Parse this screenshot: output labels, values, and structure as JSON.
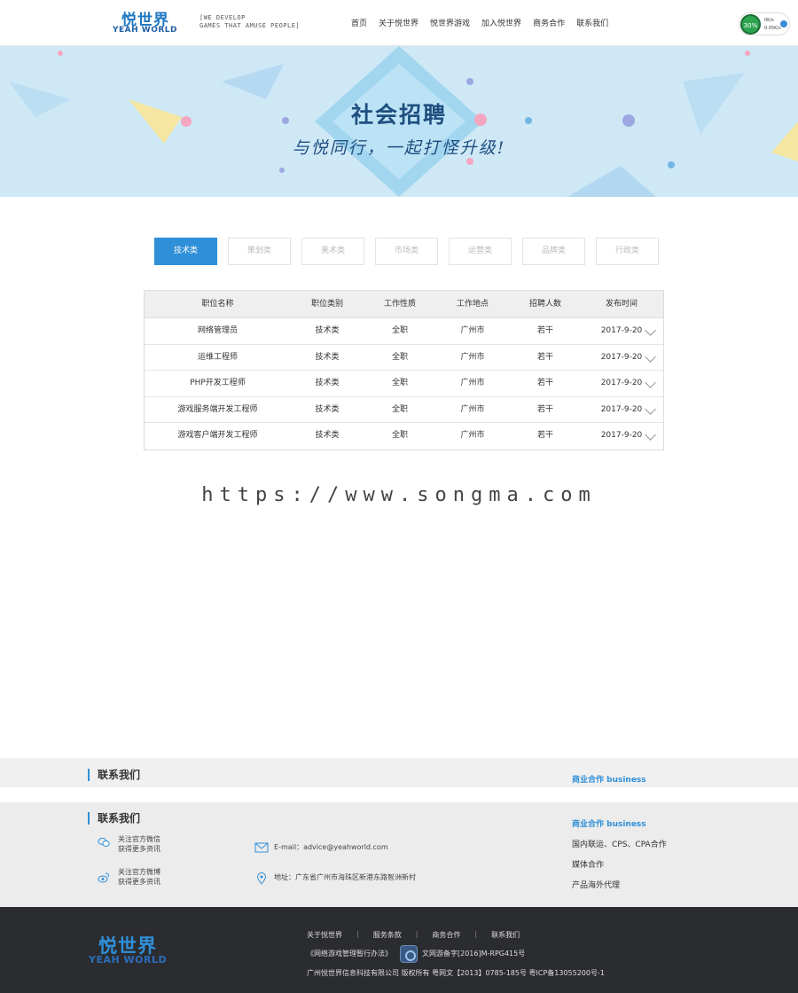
{
  "header": {
    "logo_cn": "悦世界",
    "logo_en": "YEAH WORLD",
    "slogan_line1": "[WE DEVELOP",
    "slogan_line2": "GAMES THAT AMUSE PEOPLE]",
    "nav": [
      "首页",
      "关于悦世界",
      "悦世界游戏",
      "加入悦世界",
      "商务合作",
      "联系我们"
    ],
    "speed_percent": "30%",
    "speed_up": "0K/s",
    "speed_down": "0.05K/s"
  },
  "banner": {
    "title": "社会招聘",
    "subtitle": "与悦同行，一起打怪升级!",
    "colors": {
      "bg": "#cfe8f6",
      "text": "#1e4f80"
    }
  },
  "tabs": [
    "技术类",
    "策划类",
    "美术类",
    "市场类",
    "运营类",
    "品牌类",
    "行政类"
  ],
  "jobs": {
    "headers": [
      "职位名称",
      "职位类别",
      "工作性质",
      "工作地点",
      "招聘人数",
      "发布时间"
    ],
    "rows": [
      [
        "网络管理员",
        "技术类",
        "全职",
        "广州市",
        "若干",
        "2017-9-20"
      ],
      [
        "运维工程师",
        "技术类",
        "全职",
        "广州市",
        "若干",
        "2017-9-20"
      ],
      [
        "PHP开发工程师",
        "技术类",
        "全职",
        "广州市",
        "若干",
        "2017-9-20"
      ],
      [
        "游戏服务端开发工程师",
        "技术类",
        "全职",
        "广州市",
        "若干",
        "2017-9-20"
      ],
      [
        "游戏客户端开发工程师",
        "技术类",
        "全职",
        "广州市",
        "若干",
        "2017-9-20"
      ]
    ]
  },
  "watermark": "https://www.songma.com",
  "strip": {
    "title": "联系我们",
    "biz": "商业合作 business"
  },
  "contact": {
    "title": "联系我们",
    "wechat_line1": "关注官方微信",
    "wechat_line2": "获得更多资讯",
    "weibo_line1": "关注官方微博",
    "weibo_line2": "获得更多资讯",
    "email": "E-mail：advice@yeahworld.com",
    "address": "地址：广东省广州市海珠区新港东路智洲新村",
    "biz_title": "商业合作 business",
    "biz_items": [
      "国内联运、CPS、CPA合作",
      "媒体合作",
      "产品海外代理"
    ]
  },
  "footer": {
    "logo_cn": "悦世界",
    "logo_en": "YEAH WORLD",
    "links": [
      "关于悦世界",
      "服务条款",
      "商务合作",
      "联系我们"
    ],
    "license": "《网络游戏管理暂行办法》",
    "license_no": "文网游备字[2016]M-RPG415号",
    "copyright": "广州悦世界信息科技有限公司 版权所有 粤网文【2013】0785-185号 粤ICP备13055200号-1"
  },
  "accent_color": "#2f8fd8"
}
